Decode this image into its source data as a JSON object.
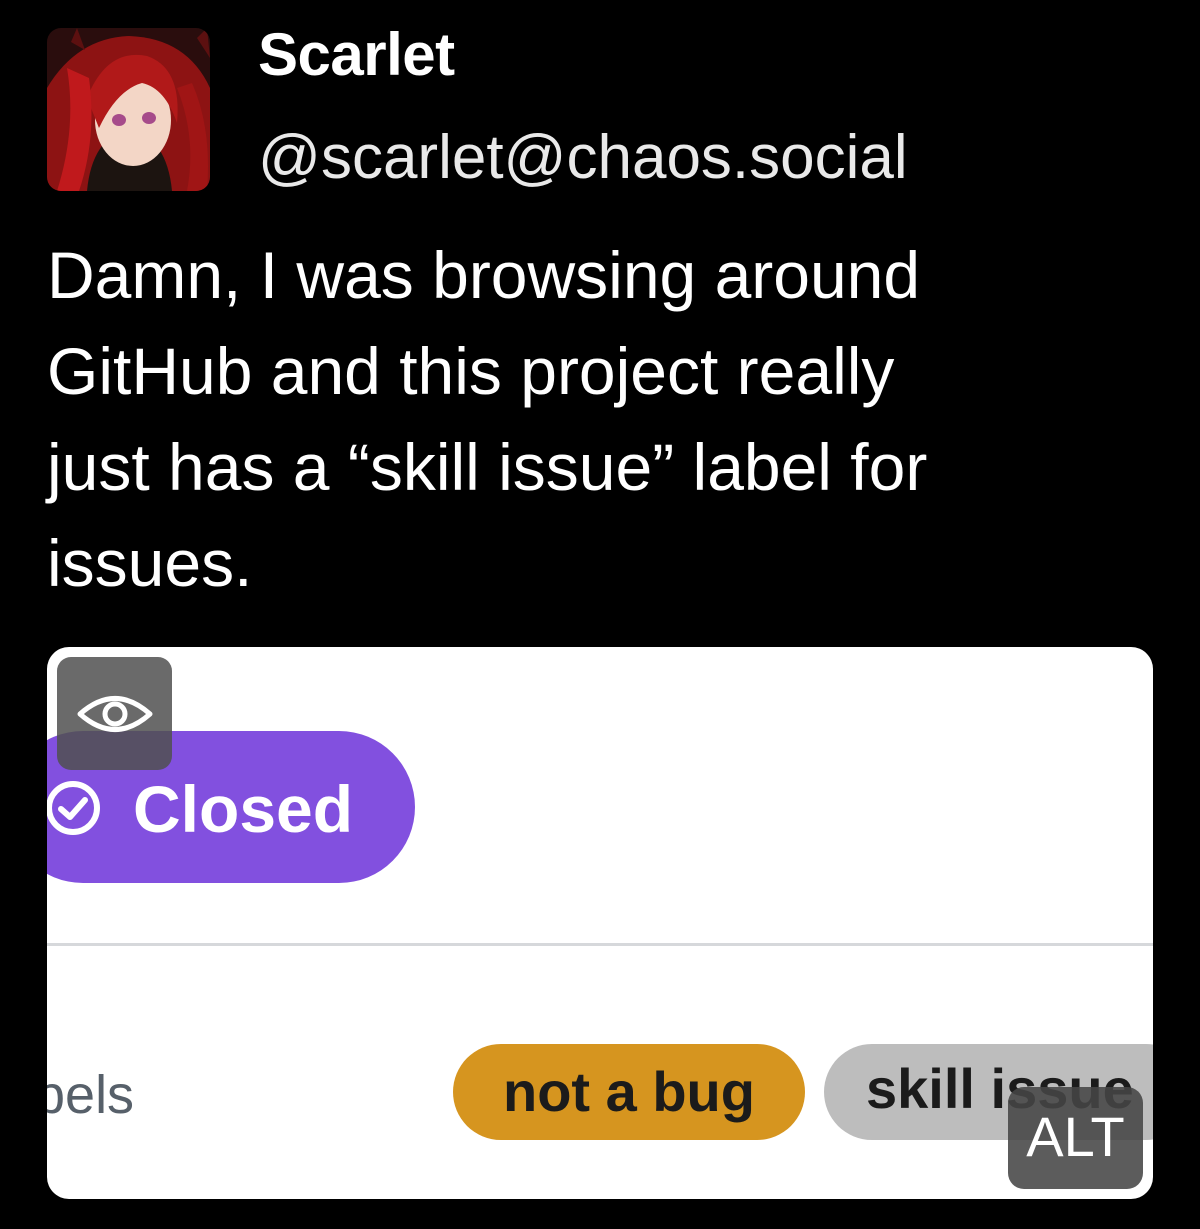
{
  "post": {
    "display_name": "Scarlet",
    "handle": "@scarlet@chaos.social",
    "avatar_icon": "anime-character-avatar",
    "text_lines": [
      "Damn, I was browsing around",
      "GitHub and this project really",
      "just has a “skill issue” label for",
      "issues."
    ]
  },
  "media": {
    "reveal_icon": "eye-icon",
    "status_icon": "check-circle-icon",
    "status_label": "Closed",
    "labels_heading": "bels",
    "labels": [
      {
        "text": "not a bug",
        "color": "#d6951f"
      },
      {
        "text": "skill issue",
        "color": "#bdbdbd"
      }
    ],
    "alt_badge": "ALT"
  },
  "colors": {
    "background": "#000000",
    "closed_purple": "#8250df",
    "label_orange": "#d6951f",
    "label_gray": "#bdbdbd"
  }
}
